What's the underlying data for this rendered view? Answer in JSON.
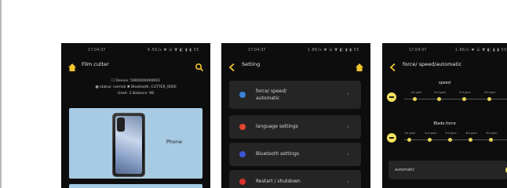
{
  "screens": [
    {
      "status_time": "17:04:37",
      "status_icons": "4.5K/s ✱ ☰ ▼ ◧ ▮ ▮ 55",
      "title": "Film cutter",
      "info_lines": [
        "☐ Device: 5900000000001",
        "▦ status: normal  ✱ Bluetooth: CUTTER_0000",
        "Used: 2  Balance: 98"
      ],
      "card_label": "Phone",
      "colors": {
        "accent": "#f3c52d",
        "card": "#a8cbe4"
      }
    },
    {
      "status_time": "17:04:37",
      "status_icons": "1.8K/s ✱ ☰ ▼ ◧ ▮ ▮ 55",
      "title": "Setting",
      "menu": [
        {
          "label_line1": "force/ speed/",
          "label_line2": "automatic",
          "icon": "gauge-icon",
          "color": "#3b82d6"
        },
        {
          "label_line1": "language settings",
          "label_line2": "",
          "icon": "globe-icon",
          "color": "#e0452f"
        },
        {
          "label_line1": "Bluetooth settings",
          "label_line2": "",
          "icon": "bluetooth-icon",
          "color": "#3b57d6"
        },
        {
          "label_line1": "Restart / shutdown",
          "label_line2": "",
          "icon": "power-icon",
          "color": "#d9332b"
        }
      ]
    },
    {
      "status_time": "17:04:37",
      "status_icons": "1.8K/s ✱ ☰ ▼ ◧ ▮ ▮ 55",
      "title": "force/ speed/automatic",
      "speed_title": "speed",
      "speed_labels": [
        "1st gear",
        "2nd gear",
        "3rd gear",
        "4th gear"
      ],
      "blade_title": "Blade force",
      "blade_labels": [
        "1st gear",
        "2nd gear",
        "3rd gear",
        "4th gear",
        "5th gear"
      ],
      "auto_label": "automatic"
    }
  ]
}
